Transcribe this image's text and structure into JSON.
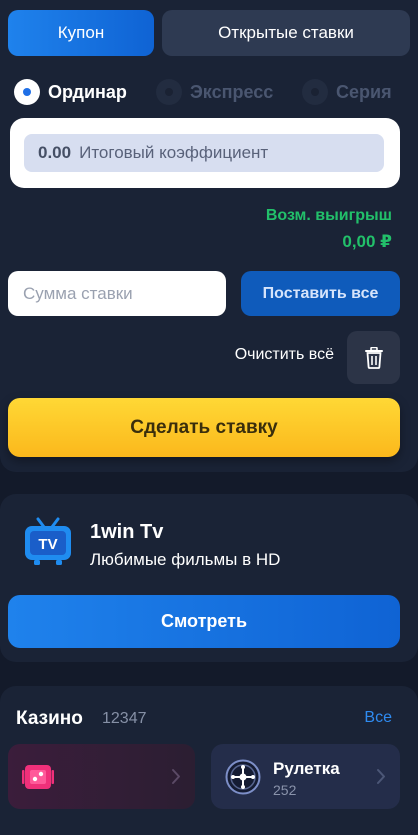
{
  "tabs": {
    "coupon_label": "Купон",
    "open_bets_label": "Открытые ставки"
  },
  "bet_types": {
    "single_label": "Ординар",
    "express_label": "Экспресс",
    "series_label": "Серия",
    "selected": "single"
  },
  "coefficient": {
    "value": "0.00",
    "label": "Итоговый коэффициент"
  },
  "winnings": {
    "label": "Возм. выигрыш",
    "value": "0,00 ₽"
  },
  "stake": {
    "placeholder": "Сумма ставки",
    "stake_all_label": "Поставить все"
  },
  "clear": {
    "label": "Очистить всё",
    "icon": "trash-icon"
  },
  "place_bet_label": "Сделать ставку",
  "tv": {
    "icon_text": "TV",
    "title": "1win Tv",
    "subtitle": "Любимые фильмы в HD",
    "watch_label": "Смотреть"
  },
  "casino": {
    "title": "Казино",
    "count": "12347",
    "all_label": "Все",
    "games": [
      {
        "name": "",
        "count": "",
        "icon": "slots-icon"
      },
      {
        "name": "Рулетка",
        "count": "252",
        "icon": "roulette-icon"
      }
    ]
  },
  "colors": {
    "accent_blue": "#1f82ec",
    "win_green": "#22c06a",
    "bet_yellow": "#ffd835",
    "background": "#131a2a",
    "panel": "#1a2336"
  }
}
